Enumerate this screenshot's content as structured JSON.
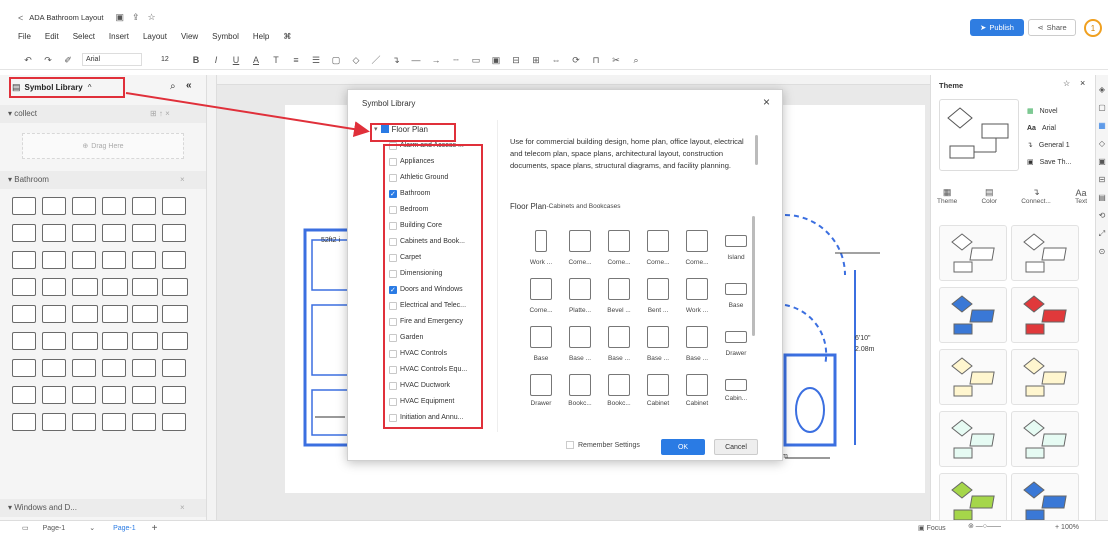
{
  "window": {
    "title": "ADA Bathroom Layout",
    "back": "<"
  },
  "menu": [
    "File",
    "Edit",
    "Select",
    "Insert",
    "Layout",
    "View",
    "Symbol",
    "Help"
  ],
  "actions": {
    "publish": "Publish",
    "share": "Share",
    "user_count": "1"
  },
  "toolbar": {
    "font": "Arial",
    "size": "12",
    "bold": "B",
    "italic": "I",
    "underline": "U",
    "fontcolor": "A"
  },
  "left": {
    "header": "Symbol Library",
    "collect": "collect",
    "drag_here": "Drag Here",
    "bathroom": "Bathroom",
    "windows": "Windows and D..."
  },
  "canvas": {
    "dim_left": "52ft2 i",
    "dim_right1": "6'10\"",
    "dim_right2": "2.08m",
    "dim_bottom": "m"
  },
  "dialog": {
    "title": "Symbol Library",
    "close": "×",
    "root": "Floor Plan",
    "description": "Use for commercial building design, home plan, office layout, electrical and telecom plan, space plans, architectural layout, construction documents, space plans, structural diagrams, and facility planning.",
    "section_main": "Floor Plan",
    "section_sub": "-Cabinets and Bookcases",
    "remember": "Remember Settings",
    "ok": "OK",
    "cancel": "Cancel",
    "categories": [
      {
        "label": "Alarm and Access ...",
        "checked": false
      },
      {
        "label": "Appliances",
        "checked": false
      },
      {
        "label": "Athletic Ground",
        "checked": false
      },
      {
        "label": "Bathroom",
        "checked": true
      },
      {
        "label": "Bedroom",
        "checked": false
      },
      {
        "label": "Building Core",
        "checked": false
      },
      {
        "label": "Cabinets and Book...",
        "checked": false
      },
      {
        "label": "Carpet",
        "checked": false
      },
      {
        "label": "Dimensioning",
        "checked": false
      },
      {
        "label": "Doors and Windows",
        "checked": true
      },
      {
        "label": "Electrical and Telec...",
        "checked": false
      },
      {
        "label": "Fire and Emergency",
        "checked": false
      },
      {
        "label": "Garden",
        "checked": false
      },
      {
        "label": "HVAC Controls",
        "checked": false
      },
      {
        "label": "HVAC Controls Equ...",
        "checked": false
      },
      {
        "label": "HVAC Ductwork",
        "checked": false
      },
      {
        "label": "HVAC Equipment",
        "checked": false
      },
      {
        "label": "Initiation and Annu...",
        "checked": false
      }
    ],
    "symbols": [
      [
        "Work ...",
        "Corne...",
        "Corne...",
        "Corne...",
        "Corne...",
        "Island"
      ],
      [
        "Corne...",
        "Platte...",
        "Bevel ...",
        "Bent ...",
        "Work ...",
        "Base"
      ],
      [
        "Base",
        "Base ...",
        "Base ...",
        "Base ...",
        "Base ...",
        "Drawer"
      ],
      [
        "Drawer",
        "Bookc...",
        "Bookc...",
        "Cabinet",
        "Cabinet",
        "Cabin..."
      ]
    ]
  },
  "theme": {
    "title": "Theme",
    "opts": [
      "Novel",
      "Arial",
      "General 1",
      "Save Th..."
    ],
    "tabs": [
      "Theme",
      "Color",
      "Connect...",
      "Text"
    ]
  },
  "status": {
    "page_sel": "Page-1",
    "page_tab": "Page-1",
    "add": "+",
    "focus": "Focus",
    "zoom": "100%"
  }
}
